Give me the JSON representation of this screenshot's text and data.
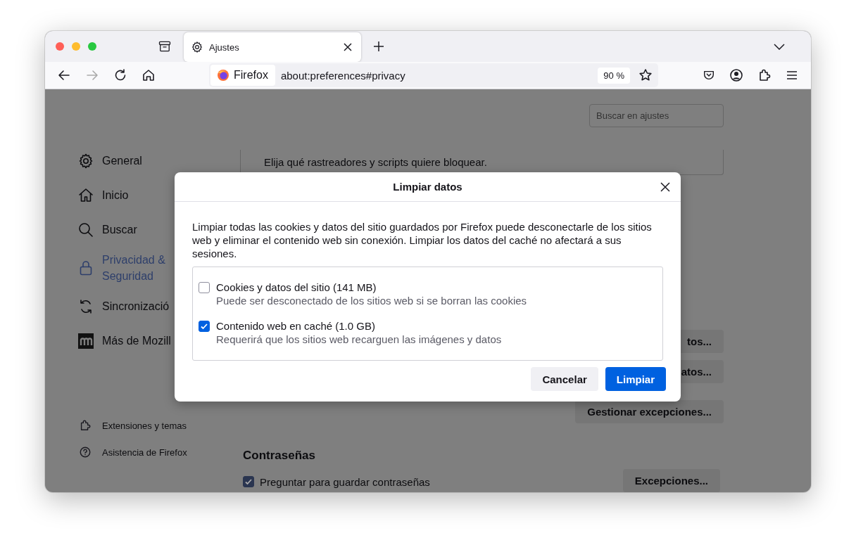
{
  "tabs": [
    {
      "label": "Ajustes",
      "selected": true
    }
  ],
  "address_bar": {
    "site_label": "Firefox",
    "url": "about:preferences#privacy",
    "zoom": "90 %"
  },
  "search": {
    "placeholder": "Buscar en ajustes"
  },
  "sidebar": {
    "items": [
      {
        "label": "General",
        "selected": false
      },
      {
        "label": "Inicio",
        "selected": false
      },
      {
        "label": "Buscar",
        "selected": false
      },
      {
        "label": "Privacidad & Seguridad",
        "selected": true
      },
      {
        "label": "Sincronizació",
        "selected": false
      },
      {
        "label": "Más de Mozill",
        "selected": false
      }
    ],
    "footer_items": [
      {
        "label": "Extensiones y temas"
      },
      {
        "label": "Asistencia de Firefox"
      }
    ]
  },
  "tracking_box": {
    "text": "Elija qué rastreadores y scripts quiere bloquear."
  },
  "side_buttons": [
    "tos...",
    "atos...",
    "Gestionar excepciones..."
  ],
  "passwords": {
    "heading": "Contraseñas",
    "ask_to_save": {
      "label": "Preguntar para guardar contraseñas",
      "checked": true
    },
    "exceptions_button": "Excepciones..."
  },
  "dialog": {
    "title": "Limpiar datos",
    "description": "Limpiar todas las cookies y datos del sitio guardados por Firefox puede desconectarle de los sitios web y eliminar el contenido web sin conexión. Limpiar los datos del caché no afectará a sus sesiones.",
    "options": [
      {
        "label": "Cookies y datos del sitio (141 MB)",
        "description": "Puede ser desconectado de los sitios web si se borran las cookies",
        "checked": false
      },
      {
        "label": "Contenido web en caché (1.0 GB)",
        "description": "Requerirá que los sitios web recarguen las imágenes y datos",
        "checked": true
      }
    ],
    "buttons": [
      {
        "label": "Cancelar",
        "kind": "secondary"
      },
      {
        "label": "Limpiar",
        "kind": "primary"
      }
    ]
  }
}
